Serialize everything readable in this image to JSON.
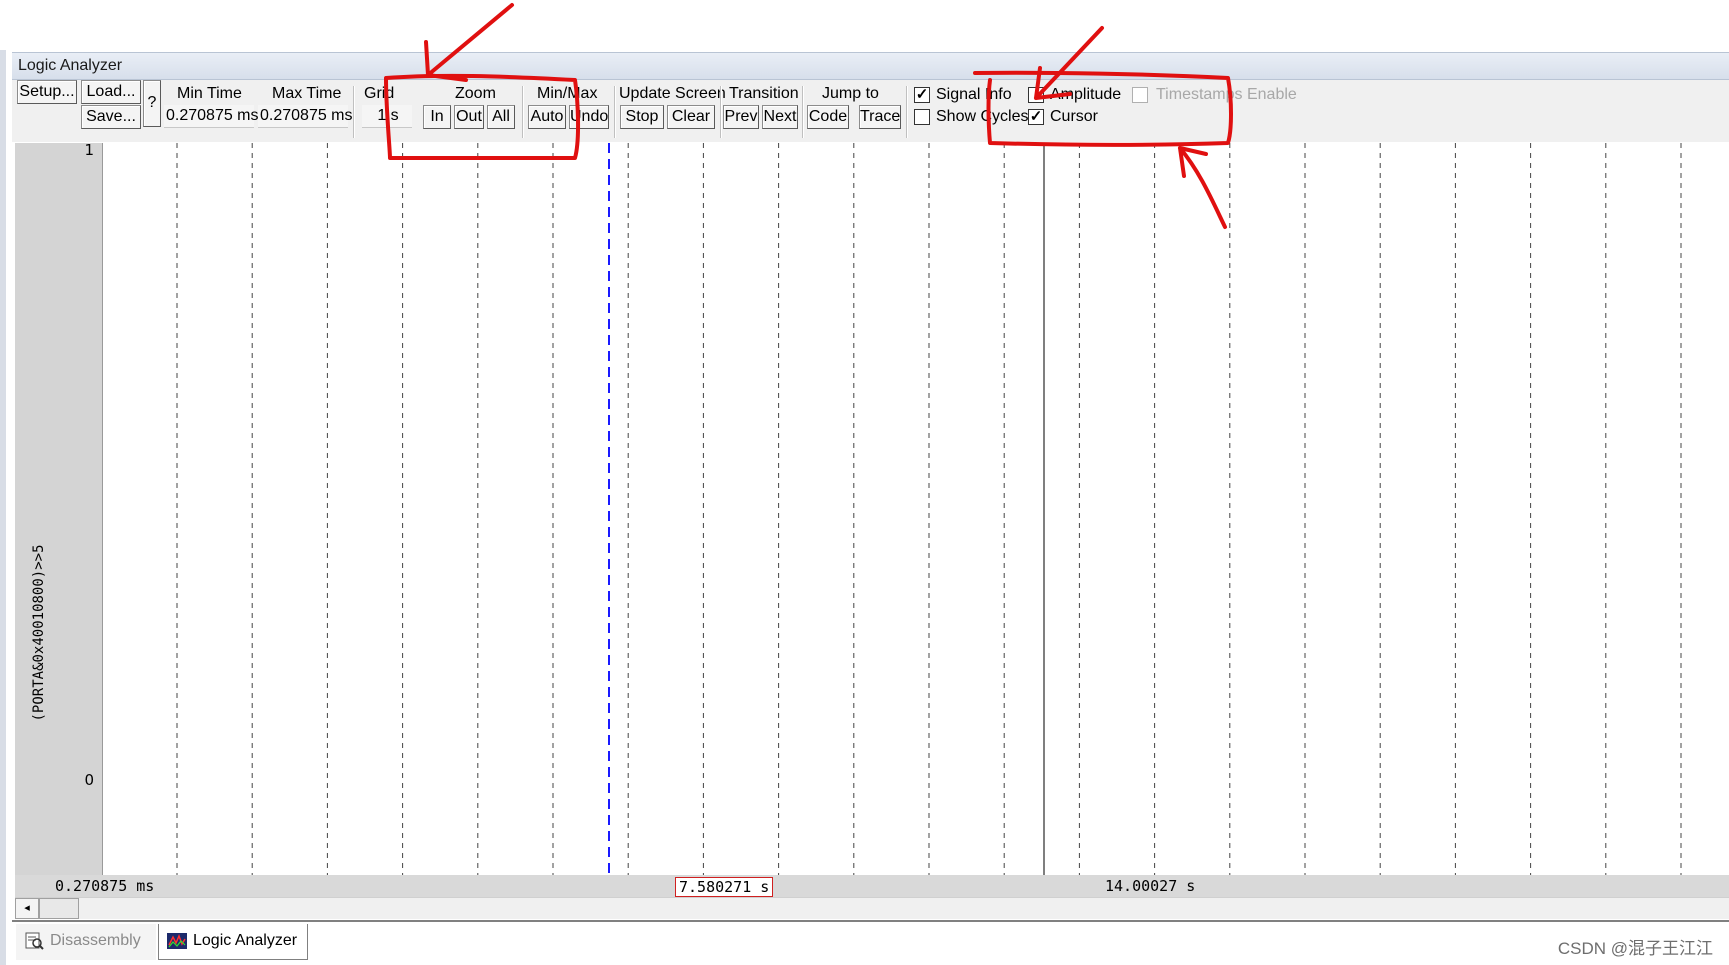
{
  "window": {
    "title": "Logic Analyzer"
  },
  "toolbar": {
    "setup_label": "Setup...",
    "load_label": "Load...",
    "save_label": "Save...",
    "help_label": "?",
    "min_time": {
      "label": "Min Time",
      "value": "0.270875 ms"
    },
    "max_time": {
      "label": "Max Time",
      "value": "0.270875 ms"
    },
    "grid": {
      "label": "Grid",
      "value": "1 s"
    },
    "zoom": {
      "label": "Zoom",
      "in": "In",
      "out": "Out",
      "all": "All"
    },
    "minmax": {
      "label": "Min/Max",
      "auto": "Auto",
      "undo": "Undo"
    },
    "update_screen": {
      "label": "Update Screen",
      "stop": "Stop",
      "clear": "Clear"
    },
    "transition": {
      "label": "Transition",
      "prev": "Prev",
      "next": "Next"
    },
    "jump_to": {
      "label": "Jump to",
      "code": "Code",
      "trace": "Trace"
    },
    "options": {
      "signal_info": {
        "label": "Signal Info",
        "checked": true
      },
      "show_cycles": {
        "label": "Show Cycles",
        "checked": false
      },
      "amplitude": {
        "label": "Amplitude",
        "checked": false
      },
      "cursor": {
        "label": "Cursor",
        "checked": true
      },
      "timestamps_enable": {
        "label": "Timestamps Enable",
        "checked": false,
        "enabled": false
      }
    }
  },
  "plot": {
    "signal_name": "(PORTA&0x40010800)>>5",
    "y_top": "1",
    "y_bottom": "0",
    "time_start": "0.270875 ms",
    "cursor_time": "7.580271 s",
    "marker_time": "14.00027 s"
  },
  "tabs": [
    {
      "label": "Disassembly",
      "active": false,
      "icon": "disassembly-icon"
    },
    {
      "label": "Logic Analyzer",
      "active": true,
      "icon": "logic-analyzer-icon"
    }
  ],
  "watermark": "CSDN @混子王江江",
  "colors": {
    "annotation": "#e01010",
    "cursor_line": "#1a1aff",
    "title_bar": "#dde4ef"
  }
}
